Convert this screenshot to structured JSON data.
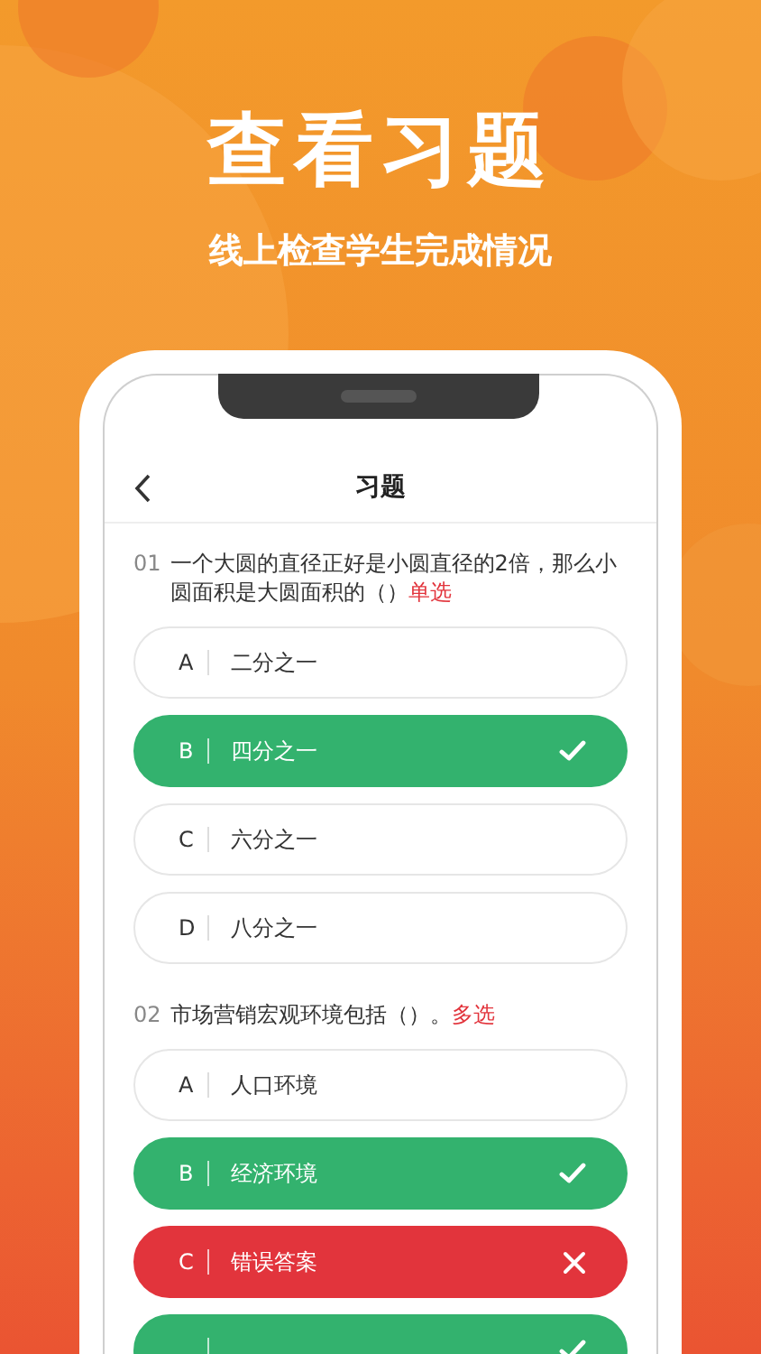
{
  "headline": "查看习题",
  "subtitle": "线上检查学生完成情况",
  "screen": {
    "title": "习题"
  },
  "questions": [
    {
      "number": "01",
      "text": "一个大圆的直径正好是小圆直径的2倍，那么小圆面积是大圆面积的（）",
      "type_label": "单选",
      "options": [
        {
          "letter": "A",
          "text": "二分之一",
          "selected": false
        },
        {
          "letter": "B",
          "text": "四分之一",
          "selected": true,
          "correct": true
        },
        {
          "letter": "C",
          "text": "六分之一",
          "selected": false
        },
        {
          "letter": "D",
          "text": "八分之一",
          "selected": false
        }
      ]
    },
    {
      "number": "02",
      "text": "市场营销宏观环境包括（）。",
      "type_label": "多选",
      "options": [
        {
          "letter": "A",
          "text": "人口环境",
          "selected": false
        },
        {
          "letter": "B",
          "text": "经济环境",
          "selected": true,
          "correct": true
        },
        {
          "letter": "C",
          "text": "错误答案",
          "selected": true,
          "correct": false
        },
        {
          "selected": true,
          "correct": true
        }
      ]
    }
  ]
}
